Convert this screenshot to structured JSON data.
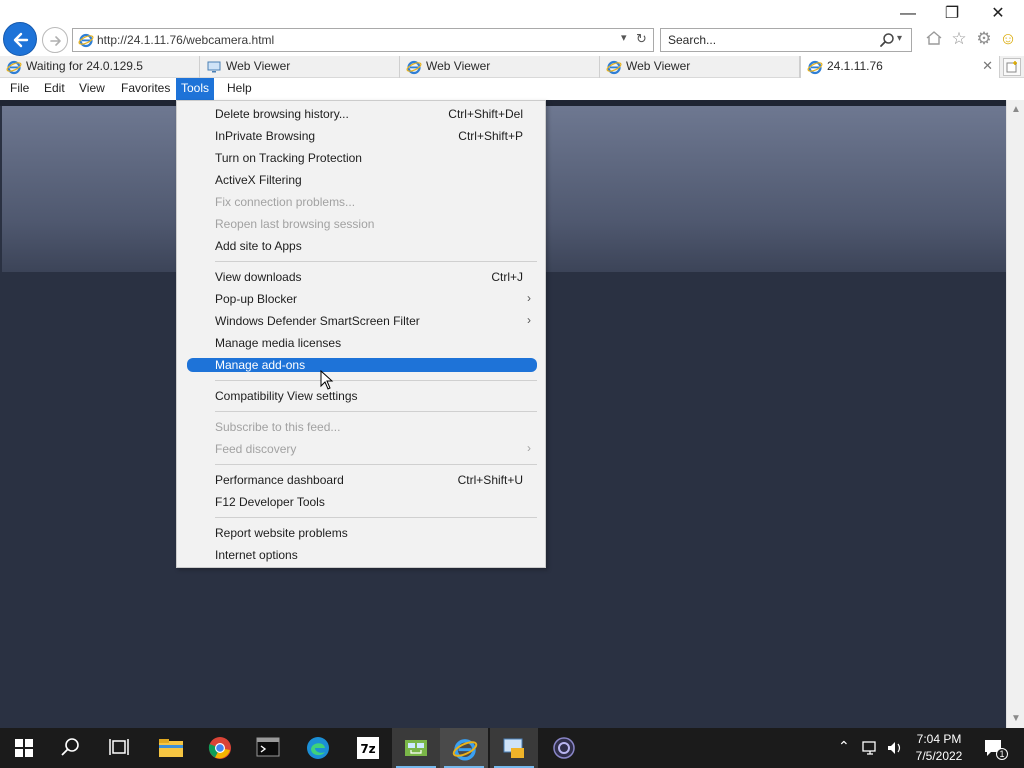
{
  "browser": {
    "address_url": "http://24.1.11.76/webcamera.html",
    "search_placeholder": "Search..."
  },
  "tabs": [
    {
      "label": "Waiting for 24.0.129.5",
      "icon": "ie-icon"
    },
    {
      "label": "Web Viewer",
      "icon": "monitor-icon"
    },
    {
      "label": "Web Viewer",
      "icon": "ie-icon"
    },
    {
      "label": "Web Viewer",
      "icon": "ie-icon"
    },
    {
      "label": "24.1.11.76",
      "icon": "ie-icon",
      "active": true
    }
  ],
  "menubar": {
    "items": [
      "File",
      "Edit",
      "View",
      "Favorites",
      "Tools",
      "Help"
    ],
    "active": "Tools"
  },
  "tools_menu": {
    "items": [
      {
        "label": "Delete browsing history...",
        "shortcut": "Ctrl+Shift+Del"
      },
      {
        "label": "InPrivate Browsing",
        "shortcut": "Ctrl+Shift+P"
      },
      {
        "label": "Turn on Tracking Protection"
      },
      {
        "label": "ActiveX Filtering"
      },
      {
        "label": "Fix connection problems...",
        "disabled": true
      },
      {
        "label": "Reopen last browsing session",
        "disabled": true
      },
      {
        "label": "Add site to Apps"
      },
      {
        "label": "View downloads",
        "shortcut": "Ctrl+J"
      },
      {
        "label": "Pop-up Blocker",
        "submenu": true
      },
      {
        "label": "Windows Defender SmartScreen Filter",
        "submenu": true
      },
      {
        "label": "Manage media licenses"
      },
      {
        "label": "Manage add-ons",
        "highlighted": true
      },
      {
        "label": "Compatibility View settings"
      },
      {
        "label": "Subscribe to this feed...",
        "disabled": true
      },
      {
        "label": "Feed discovery",
        "disabled": true,
        "submenu": true
      },
      {
        "label": "Performance dashboard",
        "shortcut": "Ctrl+Shift+U"
      },
      {
        "label": "F12 Developer Tools"
      },
      {
        "label": "Report website problems"
      },
      {
        "label": "Internet options"
      }
    ]
  },
  "taskbar": {
    "clock_time": "7:04 PM",
    "clock_date": "7/5/2022",
    "notification_count": "1",
    "apps": [
      "start-icon",
      "search-icon",
      "task-view-icon",
      "file-explorer-icon",
      "chrome-icon",
      "terminal-icon",
      "edge-icon",
      "7zip-icon",
      "network-tool-icon",
      "ie-icon",
      "remote-desktop-icon",
      "obs-icon"
    ]
  },
  "colors": {
    "accent": "#1e73d8",
    "page_background": "#2a3142",
    "taskbar": "#1b1b1b"
  }
}
